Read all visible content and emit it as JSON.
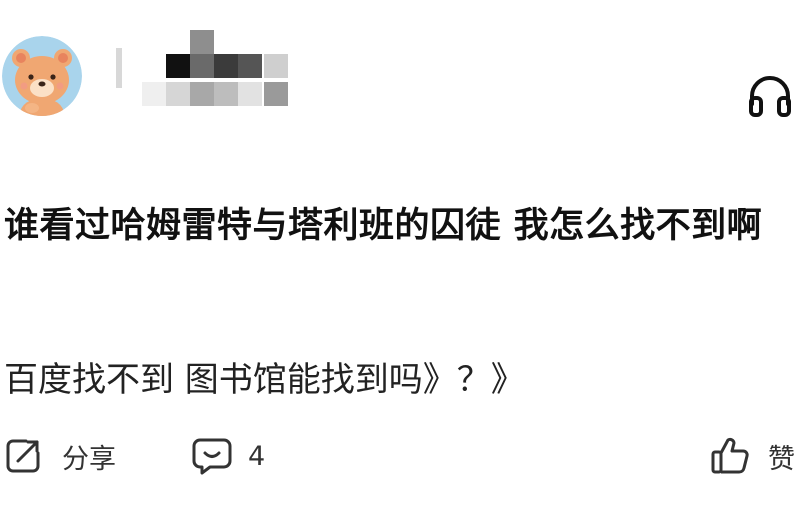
{
  "post": {
    "title": "谁看过哈姆雷特与塔利班的囚徒 我怎么找不到啊",
    "body": "百度找不到 图书馆能找到吗》？》"
  },
  "header": {
    "avatar_icon": "bear-avatar-icon",
    "username": "",
    "listen_icon": "headphones-icon"
  },
  "footer": {
    "share_label": "分享",
    "share_icon": "share-icon",
    "comment_count": "4",
    "comment_icon": "comment-icon",
    "like_label": "赞",
    "like_icon": "thumbs-up-icon"
  },
  "colors": {
    "avatar_bg": "#a9d4ec",
    "bear_fur": "#f0a772",
    "bear_ear_inner": "#e8845e",
    "bear_muzzle": "#fbe0c6",
    "text": "#111111",
    "icon": "#333333"
  }
}
